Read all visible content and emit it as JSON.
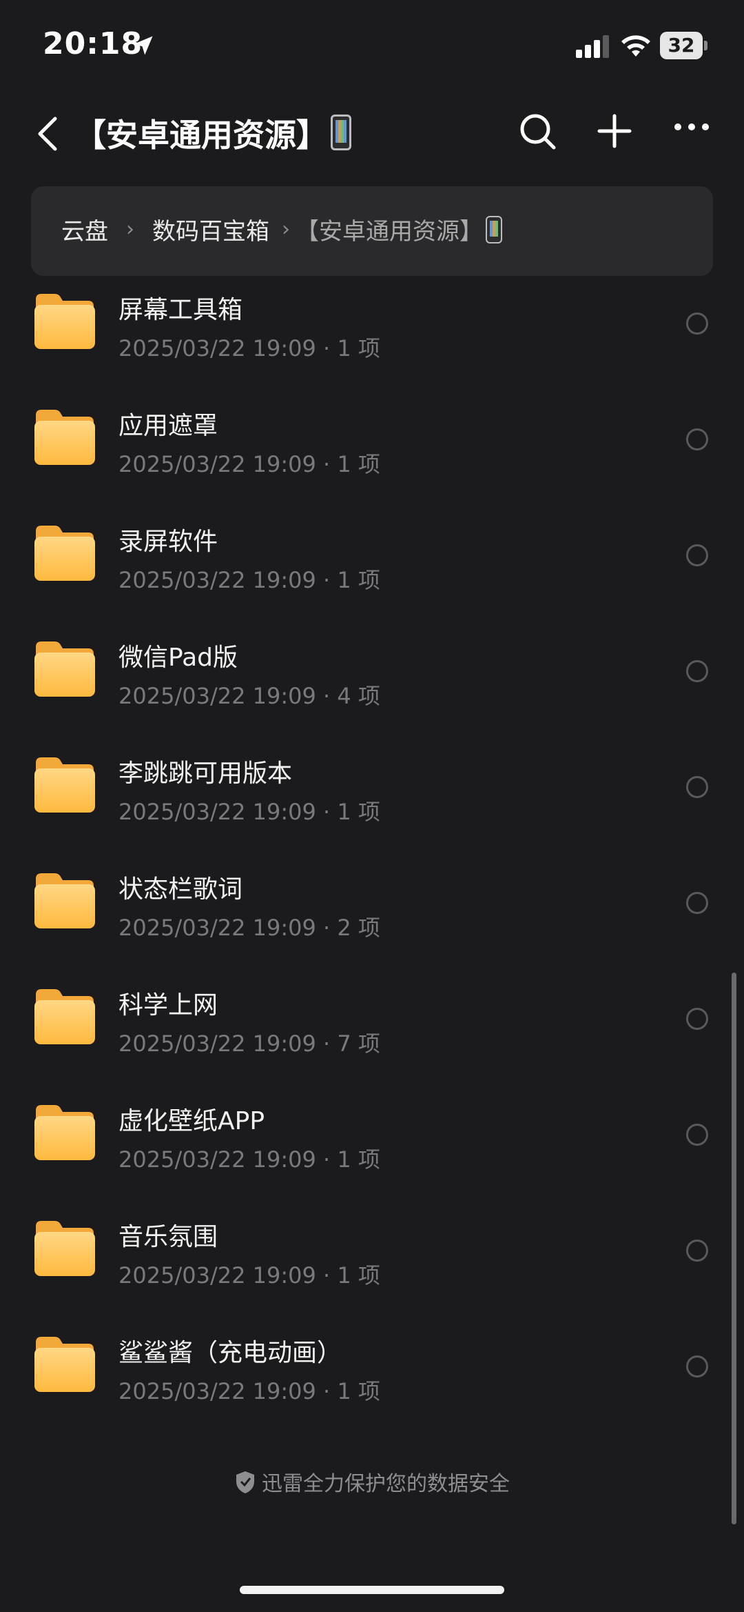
{
  "status_bar": {
    "time": "20:18",
    "battery": "32"
  },
  "nav": {
    "title": "【安卓通用资源】"
  },
  "breadcrumb": {
    "items": [
      "云盘",
      "数码百宝箱"
    ],
    "current": "【安卓通用资源】"
  },
  "folders": [
    {
      "name": "屏幕工具箱",
      "date": "2025/03/22 19:09",
      "count": "1 项"
    },
    {
      "name": "应用遮罩",
      "date": "2025/03/22 19:09",
      "count": "1 项"
    },
    {
      "name": "录屏软件",
      "date": "2025/03/22 19:09",
      "count": "1 项"
    },
    {
      "name": "微信Pad版",
      "date": "2025/03/22 19:09",
      "count": "4 项"
    },
    {
      "name": "李跳跳可用版本",
      "date": "2025/03/22 19:09",
      "count": "1 项"
    },
    {
      "name": "状态栏歌词",
      "date": "2025/03/22 19:09",
      "count": "2 项"
    },
    {
      "name": "科学上网",
      "date": "2025/03/22 19:09",
      "count": "7 项"
    },
    {
      "name": "虚化壁纸APP",
      "date": "2025/03/22 19:09",
      "count": "1 项"
    },
    {
      "name": "音乐氛围",
      "date": "2025/03/22 19:09",
      "count": "1 项"
    },
    {
      "name": "鲨鲨酱（充电动画）",
      "date": "2025/03/22 19:09",
      "count": "1 项"
    }
  ],
  "footer": {
    "security_note": "迅雷全力保护您的数据安全"
  },
  "icons": {
    "back": "chevron-left-icon",
    "search": "search-icon",
    "add": "plus-icon",
    "more": "more-dots-icon",
    "folder": "folder-icon",
    "shield": "shield-icon"
  },
  "colors": {
    "background": "#1b1b1d",
    "folder": "#ffc65a",
    "breadcrumb_bg": "#2a2a2c"
  }
}
